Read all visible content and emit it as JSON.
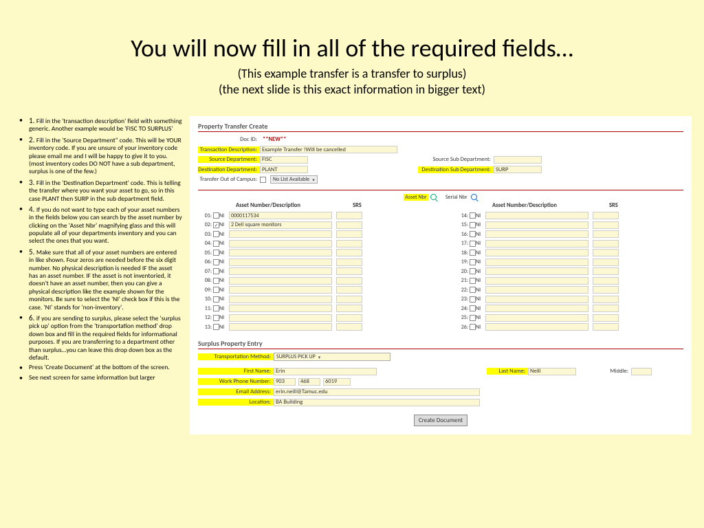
{
  "title": "You will now fill in all of the required fields…",
  "subtitle1": "(This example transfer is a transfer to surplus)",
  "subtitle2": "(the next slide is this exact information in bigger text)",
  "instructions": [
    {
      "num": "1.",
      "text": "Fill in the 'transaction description' field with something generic. Another example would be 'FISC TO SURPLUS'"
    },
    {
      "num": "2.",
      "text": "Fill in the 'Source Department\" code. This will be YOUR inventory code. If you are unsure of your inventory code please email me and I will be happy to give it to you. (most inventory codes DO NOT have a sub department, surplus is one of the few.)"
    },
    {
      "num": "3.",
      "text": "Fill in the 'Destination Department' code. This is telling the transfer where you want your asset to go, so in this case PLANT then SURP in the sub department field."
    },
    {
      "num": "4.",
      "text": "If you do not want to type each of your asset numbers in the fields below you can search by the asset number by clicking on the 'Asset Nbr' magnifying glass and this will populate all of your departments inventory and you can select the ones that you want."
    },
    {
      "num": "5.",
      "text": "Make sure that all of your asset numbers are entered in like shown. Four zeros are needed before the six digit number. No physical description is needed IF the asset has an asset number. IF the asset is not inventoried, it doesn't have an asset number, then you can give a physical description like the example shown for the monitors. Be sure to select the 'NI' check box if this is the case. 'NI' stands for 'non-inventory'."
    },
    {
      "num": "6.",
      "text": "if you are sending to surplus, please select the 'surplus pick up' option from the 'transportation method' drop down box and fill in the required fields for informational purposes. If you are transferring to a department other than surplus…you can leave this drop down box as the default."
    },
    {
      "num": "",
      "text": "Press 'Create Document' at the bottom of the screen."
    },
    {
      "num": "",
      "text": "See next screen for same information but larger"
    }
  ],
  "form": {
    "section1_title": "Property Transfer Create",
    "docid_label": "Doc ID:",
    "docid_value": "**NEW**",
    "trans_desc_label": "Transaction Description:",
    "trans_desc_value": "Example Transfer !Will be cancelled",
    "src_dept_label": "Source Department:",
    "src_dept_value": "FISC",
    "src_sub_label": "Source Sub Department:",
    "dest_dept_label": "Destination Department:",
    "dest_dept_value": "PLANT",
    "dest_sub_label": "Destination Sub Department:",
    "dest_sub_value": "SURP",
    "transfer_out_label": "Transfer Out of Campus:",
    "no_list": "No List Available",
    "asset_nbr_btn": "Asset Nbr",
    "serial_nbr_btn": "Serial Nbr",
    "col_head1": "Asset Number/Description",
    "col_head2": "SRS",
    "rows_left": [
      "01:",
      "02:",
      "03:",
      "04:",
      "05:",
      "06:",
      "07:",
      "08:",
      "09:",
      "10:",
      "11:",
      "12:",
      "13:"
    ],
    "rows_right": [
      "14:",
      "15:",
      "16:",
      "17:",
      "18:",
      "19:",
      "20:",
      "21:",
      "22:",
      "23:",
      "24:",
      "25:",
      "26:"
    ],
    "ni_label": "NI",
    "asset1_value": "0000117534",
    "asset2_value": "2 Dell square monitors",
    "surplus_title": "Surplus Property Entry",
    "transport_label": "Transportation Method:",
    "transport_value": "SURPLUS PICK UP",
    "first_name_label": "First Name:",
    "first_name_value": "Erin",
    "last_name_label": "Last Name:",
    "last_name_value": "Neill",
    "middle_label": "Middle:",
    "phone_label": "Work Phone Number:",
    "phone1": "903",
    "phone2": "468",
    "phone3": "6019",
    "email_label": "Email Address:",
    "email_value": "erin.neill@Tamuc.edu",
    "location_label": "Location:",
    "location_value": "BA Building",
    "create_btn": "Create Document"
  }
}
